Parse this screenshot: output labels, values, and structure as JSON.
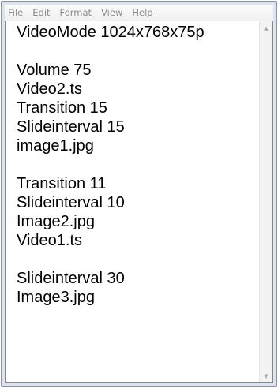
{
  "menubar": {
    "items": [
      {
        "label": "File"
      },
      {
        "label": "Edit"
      },
      {
        "label": "Format"
      },
      {
        "label": "View"
      },
      {
        "label": "Help"
      }
    ]
  },
  "editor": {
    "lines": [
      "VideoMode 1024x768x75p",
      "",
      "Volume 75",
      "Video2.ts",
      "Transition 15",
      "Slideinterval 15",
      "image1.jpg",
      "",
      "Transition 11",
      "Slideinterval 10",
      "Image2.jpg",
      "Video1.ts",
      "",
      "Slideinterval 30",
      "Image3.jpg"
    ]
  },
  "scrollbar": {
    "up_arrow": "▲",
    "down_arrow": "▼"
  }
}
